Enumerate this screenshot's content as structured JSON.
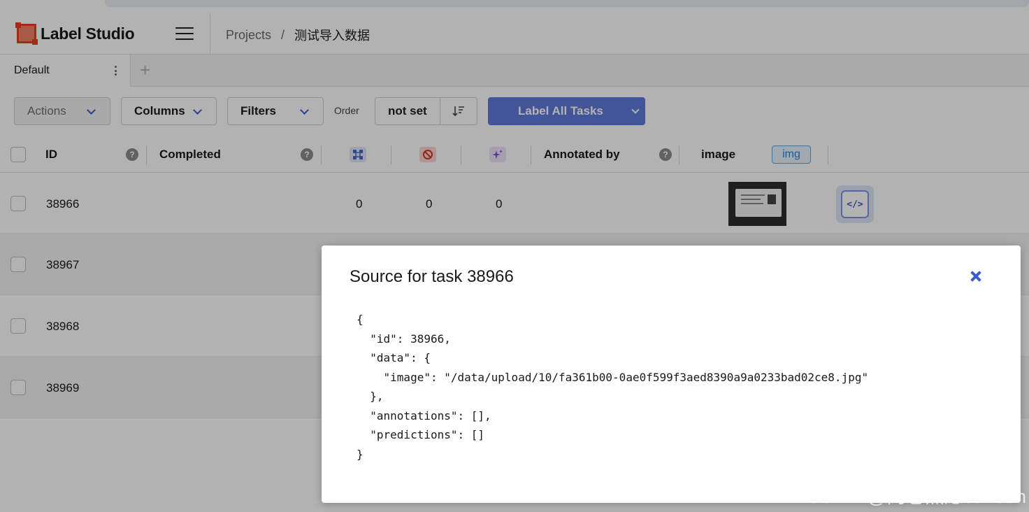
{
  "app": {
    "name": "Label Studio",
    "breadcrumb": {
      "projects": "Projects",
      "separator": "/",
      "current": "测试导入数据"
    }
  },
  "tabs": {
    "default_label": "Default",
    "add_label": "+"
  },
  "toolbar": {
    "actions_label": "Actions",
    "columns_label": "Columns",
    "filters_label": "Filters",
    "order_label": "Order",
    "order_value": "not set",
    "label_all_label": "Label All Tasks"
  },
  "table": {
    "headers": {
      "id": "ID",
      "completed": "Completed",
      "annotated_by": "Annotated by",
      "image": "image",
      "image_tag": "img",
      "help": "?"
    },
    "rows": [
      {
        "id": "38966",
        "total_annotations": "0",
        "cancelled": "0",
        "predictions": "0"
      },
      {
        "id": "38967"
      },
      {
        "id": "38968"
      },
      {
        "id": "38969"
      }
    ],
    "code_button_glyph": "</>"
  },
  "modal": {
    "title": "Source for task 38966",
    "source_json": "{\n  \"id\": 38966,\n  \"data\": {\n    \"image\": \"/data/upload/10/fa361b00-0ae0f599f3aed8390a9a0233bad02ce8.jpg\"\n  },\n  \"annotations\": [],\n  \"predictions\": []\n}"
  },
  "watermark": "CSDN @内卷焦虑sansan",
  "colors": {
    "accent": "#617ada",
    "accent_dark": "#3d5bd0",
    "logo_red": "#e8401c",
    "img_tag_blue": "#2b80d2"
  },
  "icons": {
    "menu": "hamburger-menu-icon",
    "tab_menu": "kebab-icon",
    "sort": "sort-descending-icon",
    "col_total": "annotations-total-icon",
    "col_cancelled": "cancelled-icon",
    "col_predictions": "predictions-sparkle-icon",
    "close": "close-icon",
    "code": "code-icon"
  }
}
